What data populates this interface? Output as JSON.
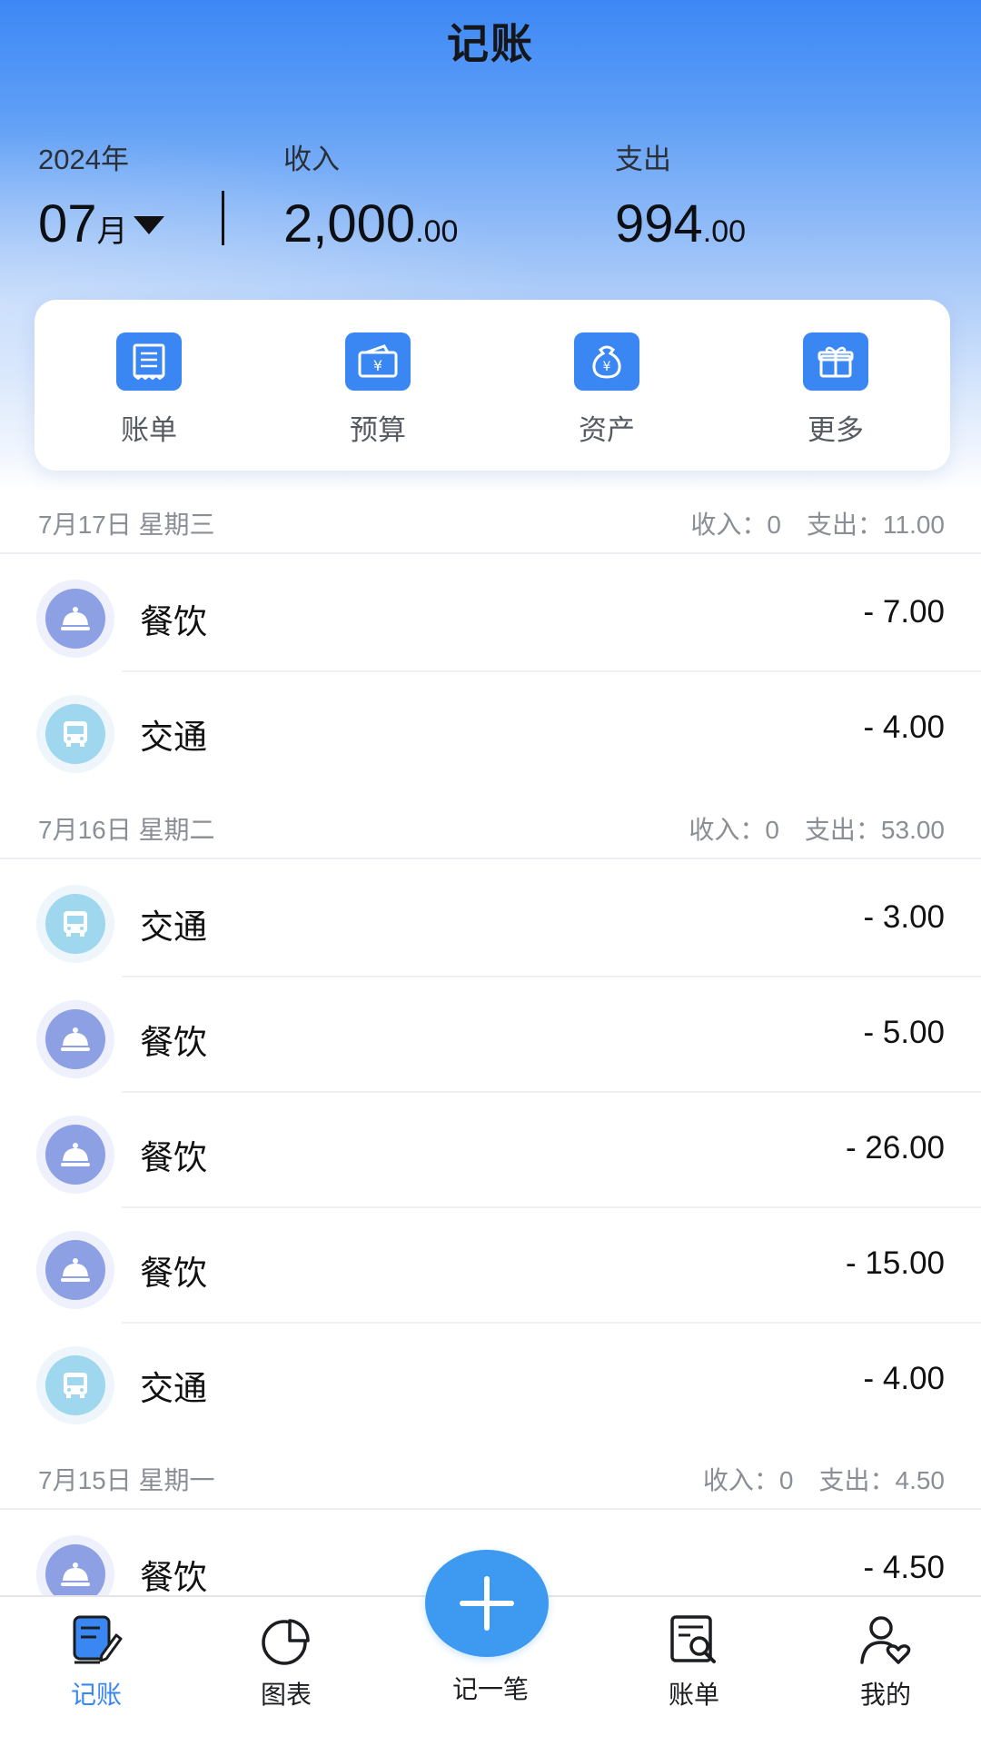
{
  "app": {
    "title": "记账"
  },
  "summary": {
    "year_label": "2024年",
    "month_value": "07",
    "month_unit": "月",
    "income_label": "收入",
    "income_main": "2,000",
    "income_cents": ".00",
    "expense_label": "支出",
    "expense_main": "994",
    "expense_cents": ".00"
  },
  "quick_actions": [
    {
      "label": "账单",
      "icon": "bill-icon"
    },
    {
      "label": "预算",
      "icon": "budget-ticket-icon"
    },
    {
      "label": "资产",
      "icon": "money-bag-icon"
    },
    {
      "label": "更多",
      "icon": "gift-box-icon"
    }
  ],
  "days": [
    {
      "date": "7月17日 星期三",
      "income_label": "收入：",
      "income": "0",
      "expense_label": "支出：",
      "expense": "11.00",
      "entries": [
        {
          "category": "餐饮",
          "type": "food",
          "amount": "- 7.00"
        },
        {
          "category": "交通",
          "type": "traffic",
          "amount": "- 4.00"
        }
      ]
    },
    {
      "date": "7月16日 星期二",
      "income_label": "收入：",
      "income": "0",
      "expense_label": "支出：",
      "expense": "53.00",
      "entries": [
        {
          "category": "交通",
          "type": "traffic",
          "amount": "- 3.00"
        },
        {
          "category": "餐饮",
          "type": "food",
          "amount": "- 5.00"
        },
        {
          "category": "餐饮",
          "type": "food",
          "amount": "- 26.00"
        },
        {
          "category": "餐饮",
          "type": "food",
          "amount": "- 15.00"
        },
        {
          "category": "交通",
          "type": "traffic",
          "amount": "- 4.00"
        }
      ]
    },
    {
      "date": "7月15日 星期一",
      "income_label": "收入：",
      "income": "0",
      "expense_label": "支出：",
      "expense": "4.50",
      "entries": [
        {
          "category": "餐饮",
          "type": "food",
          "amount": "- 4.50"
        }
      ]
    }
  ],
  "bottom_nav": {
    "items": [
      {
        "label": "记账",
        "icon": "notebook-pen-icon",
        "active": true
      },
      {
        "label": "图表",
        "icon": "pie-chart-icon",
        "active": false
      },
      {
        "label": "记一笔",
        "icon": "plus-icon",
        "active": false
      },
      {
        "label": "账单",
        "icon": "bill-search-icon",
        "active": false
      },
      {
        "label": "我的",
        "icon": "user-heart-icon",
        "active": false
      }
    ]
  },
  "colors": {
    "accent": "#3a86f2",
    "fab": "#3d9af0",
    "food_icon": "#8da0e3",
    "traffic_icon": "#9fd7ef"
  }
}
